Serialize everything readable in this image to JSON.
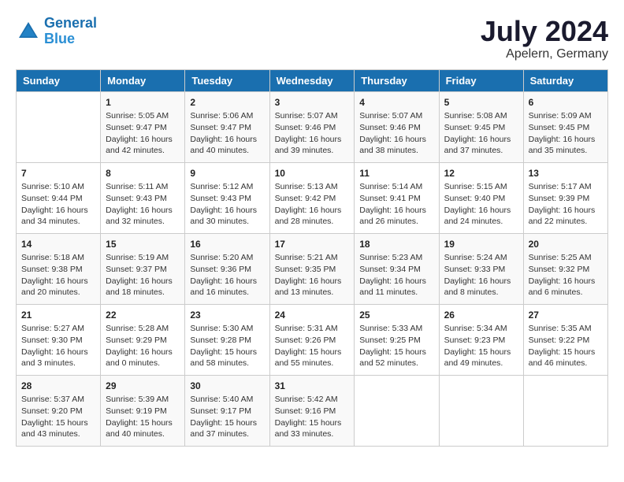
{
  "header": {
    "logo_line1": "General",
    "logo_line2": "Blue",
    "month": "July 2024",
    "location": "Apelern, Germany"
  },
  "weekdays": [
    "Sunday",
    "Monday",
    "Tuesday",
    "Wednesday",
    "Thursday",
    "Friday",
    "Saturday"
  ],
  "weeks": [
    [
      {
        "day": "",
        "info": ""
      },
      {
        "day": "1",
        "info": "Sunrise: 5:05 AM\nSunset: 9:47 PM\nDaylight: 16 hours\nand 42 minutes."
      },
      {
        "day": "2",
        "info": "Sunrise: 5:06 AM\nSunset: 9:47 PM\nDaylight: 16 hours\nand 40 minutes."
      },
      {
        "day": "3",
        "info": "Sunrise: 5:07 AM\nSunset: 9:46 PM\nDaylight: 16 hours\nand 39 minutes."
      },
      {
        "day": "4",
        "info": "Sunrise: 5:07 AM\nSunset: 9:46 PM\nDaylight: 16 hours\nand 38 minutes."
      },
      {
        "day": "5",
        "info": "Sunrise: 5:08 AM\nSunset: 9:45 PM\nDaylight: 16 hours\nand 37 minutes."
      },
      {
        "day": "6",
        "info": "Sunrise: 5:09 AM\nSunset: 9:45 PM\nDaylight: 16 hours\nand 35 minutes."
      }
    ],
    [
      {
        "day": "7",
        "info": "Sunrise: 5:10 AM\nSunset: 9:44 PM\nDaylight: 16 hours\nand 34 minutes."
      },
      {
        "day": "8",
        "info": "Sunrise: 5:11 AM\nSunset: 9:43 PM\nDaylight: 16 hours\nand 32 minutes."
      },
      {
        "day": "9",
        "info": "Sunrise: 5:12 AM\nSunset: 9:43 PM\nDaylight: 16 hours\nand 30 minutes."
      },
      {
        "day": "10",
        "info": "Sunrise: 5:13 AM\nSunset: 9:42 PM\nDaylight: 16 hours\nand 28 minutes."
      },
      {
        "day": "11",
        "info": "Sunrise: 5:14 AM\nSunset: 9:41 PM\nDaylight: 16 hours\nand 26 minutes."
      },
      {
        "day": "12",
        "info": "Sunrise: 5:15 AM\nSunset: 9:40 PM\nDaylight: 16 hours\nand 24 minutes."
      },
      {
        "day": "13",
        "info": "Sunrise: 5:17 AM\nSunset: 9:39 PM\nDaylight: 16 hours\nand 22 minutes."
      }
    ],
    [
      {
        "day": "14",
        "info": "Sunrise: 5:18 AM\nSunset: 9:38 PM\nDaylight: 16 hours\nand 20 minutes."
      },
      {
        "day": "15",
        "info": "Sunrise: 5:19 AM\nSunset: 9:37 PM\nDaylight: 16 hours\nand 18 minutes."
      },
      {
        "day": "16",
        "info": "Sunrise: 5:20 AM\nSunset: 9:36 PM\nDaylight: 16 hours\nand 16 minutes."
      },
      {
        "day": "17",
        "info": "Sunrise: 5:21 AM\nSunset: 9:35 PM\nDaylight: 16 hours\nand 13 minutes."
      },
      {
        "day": "18",
        "info": "Sunrise: 5:23 AM\nSunset: 9:34 PM\nDaylight: 16 hours\nand 11 minutes."
      },
      {
        "day": "19",
        "info": "Sunrise: 5:24 AM\nSunset: 9:33 PM\nDaylight: 16 hours\nand 8 minutes."
      },
      {
        "day": "20",
        "info": "Sunrise: 5:25 AM\nSunset: 9:32 PM\nDaylight: 16 hours\nand 6 minutes."
      }
    ],
    [
      {
        "day": "21",
        "info": "Sunrise: 5:27 AM\nSunset: 9:30 PM\nDaylight: 16 hours\nand 3 minutes."
      },
      {
        "day": "22",
        "info": "Sunrise: 5:28 AM\nSunset: 9:29 PM\nDaylight: 16 hours\nand 0 minutes."
      },
      {
        "day": "23",
        "info": "Sunrise: 5:30 AM\nSunset: 9:28 PM\nDaylight: 15 hours\nand 58 minutes."
      },
      {
        "day": "24",
        "info": "Sunrise: 5:31 AM\nSunset: 9:26 PM\nDaylight: 15 hours\nand 55 minutes."
      },
      {
        "day": "25",
        "info": "Sunrise: 5:33 AM\nSunset: 9:25 PM\nDaylight: 15 hours\nand 52 minutes."
      },
      {
        "day": "26",
        "info": "Sunrise: 5:34 AM\nSunset: 9:23 PM\nDaylight: 15 hours\nand 49 minutes."
      },
      {
        "day": "27",
        "info": "Sunrise: 5:35 AM\nSunset: 9:22 PM\nDaylight: 15 hours\nand 46 minutes."
      }
    ],
    [
      {
        "day": "28",
        "info": "Sunrise: 5:37 AM\nSunset: 9:20 PM\nDaylight: 15 hours\nand 43 minutes."
      },
      {
        "day": "29",
        "info": "Sunrise: 5:39 AM\nSunset: 9:19 PM\nDaylight: 15 hours\nand 40 minutes."
      },
      {
        "day": "30",
        "info": "Sunrise: 5:40 AM\nSunset: 9:17 PM\nDaylight: 15 hours\nand 37 minutes."
      },
      {
        "day": "31",
        "info": "Sunrise: 5:42 AM\nSunset: 9:16 PM\nDaylight: 15 hours\nand 33 minutes."
      },
      {
        "day": "",
        "info": ""
      },
      {
        "day": "",
        "info": ""
      },
      {
        "day": "",
        "info": ""
      }
    ]
  ]
}
